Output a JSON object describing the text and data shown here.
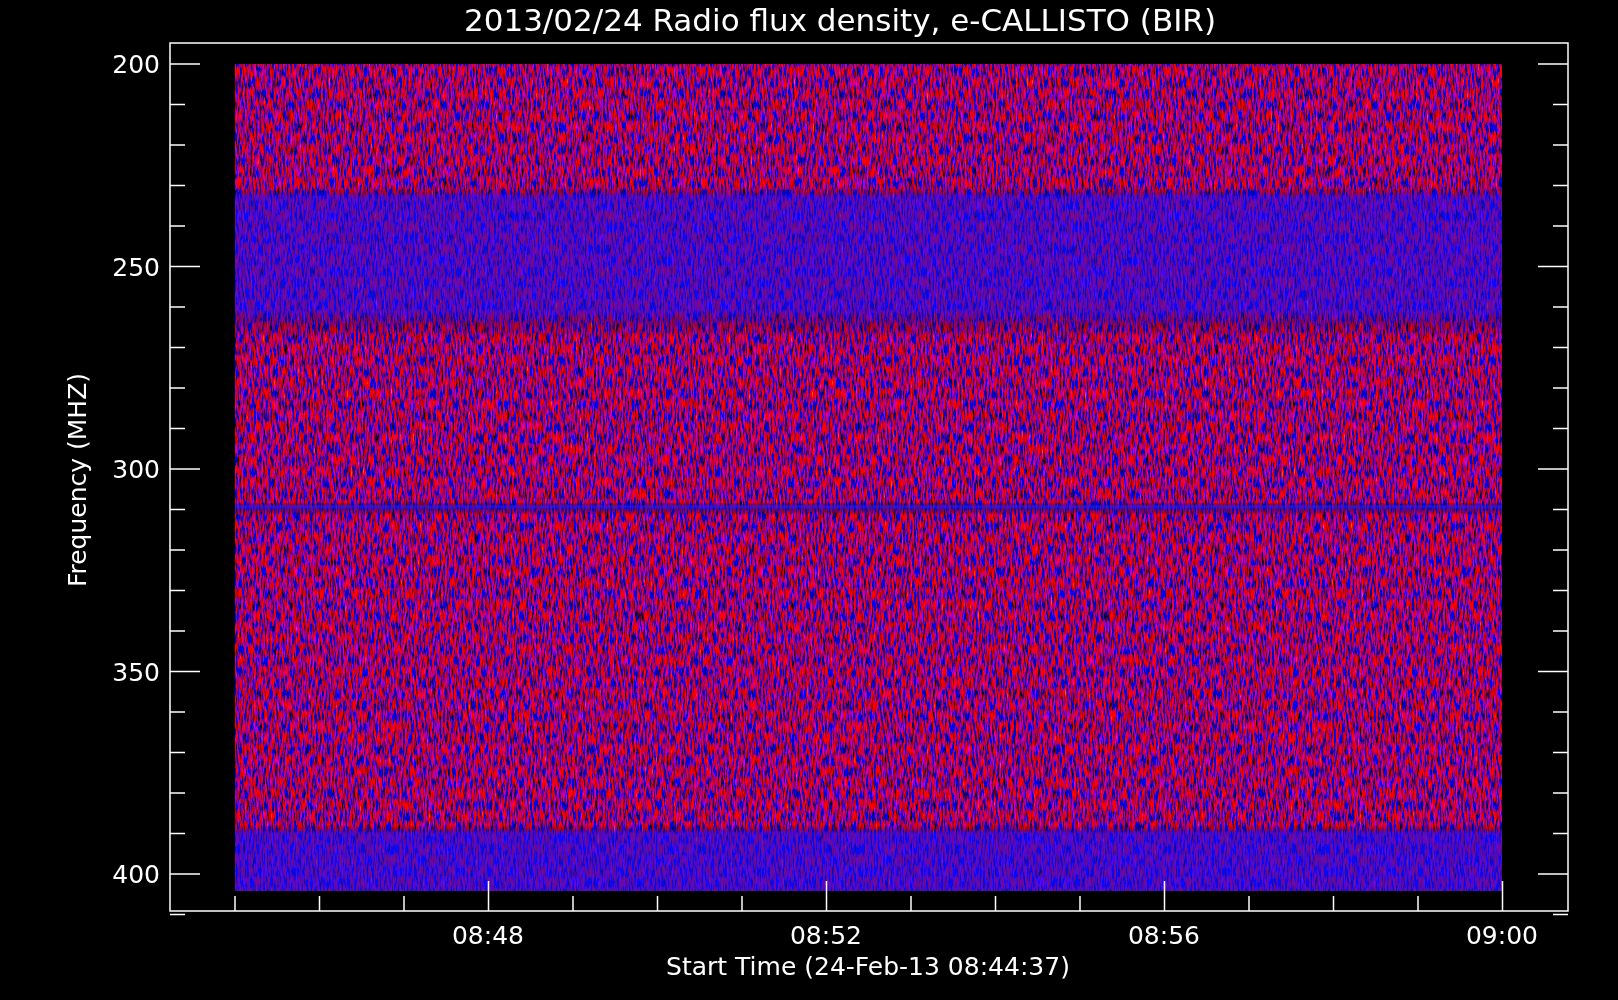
{
  "title": "2013/02/24  Radio flux density, e-CALLISTO (BIR)",
  "y_axis": {
    "label": "Frequency (MHZ)",
    "ticks": [
      "200",
      "250",
      "300",
      "350",
      "400"
    ]
  },
  "x_axis": {
    "label": "Start Time (24-Feb-13 08:44:37)",
    "ticks": [
      "08:48",
      "08:52",
      "08:56",
      "09:00"
    ]
  }
}
